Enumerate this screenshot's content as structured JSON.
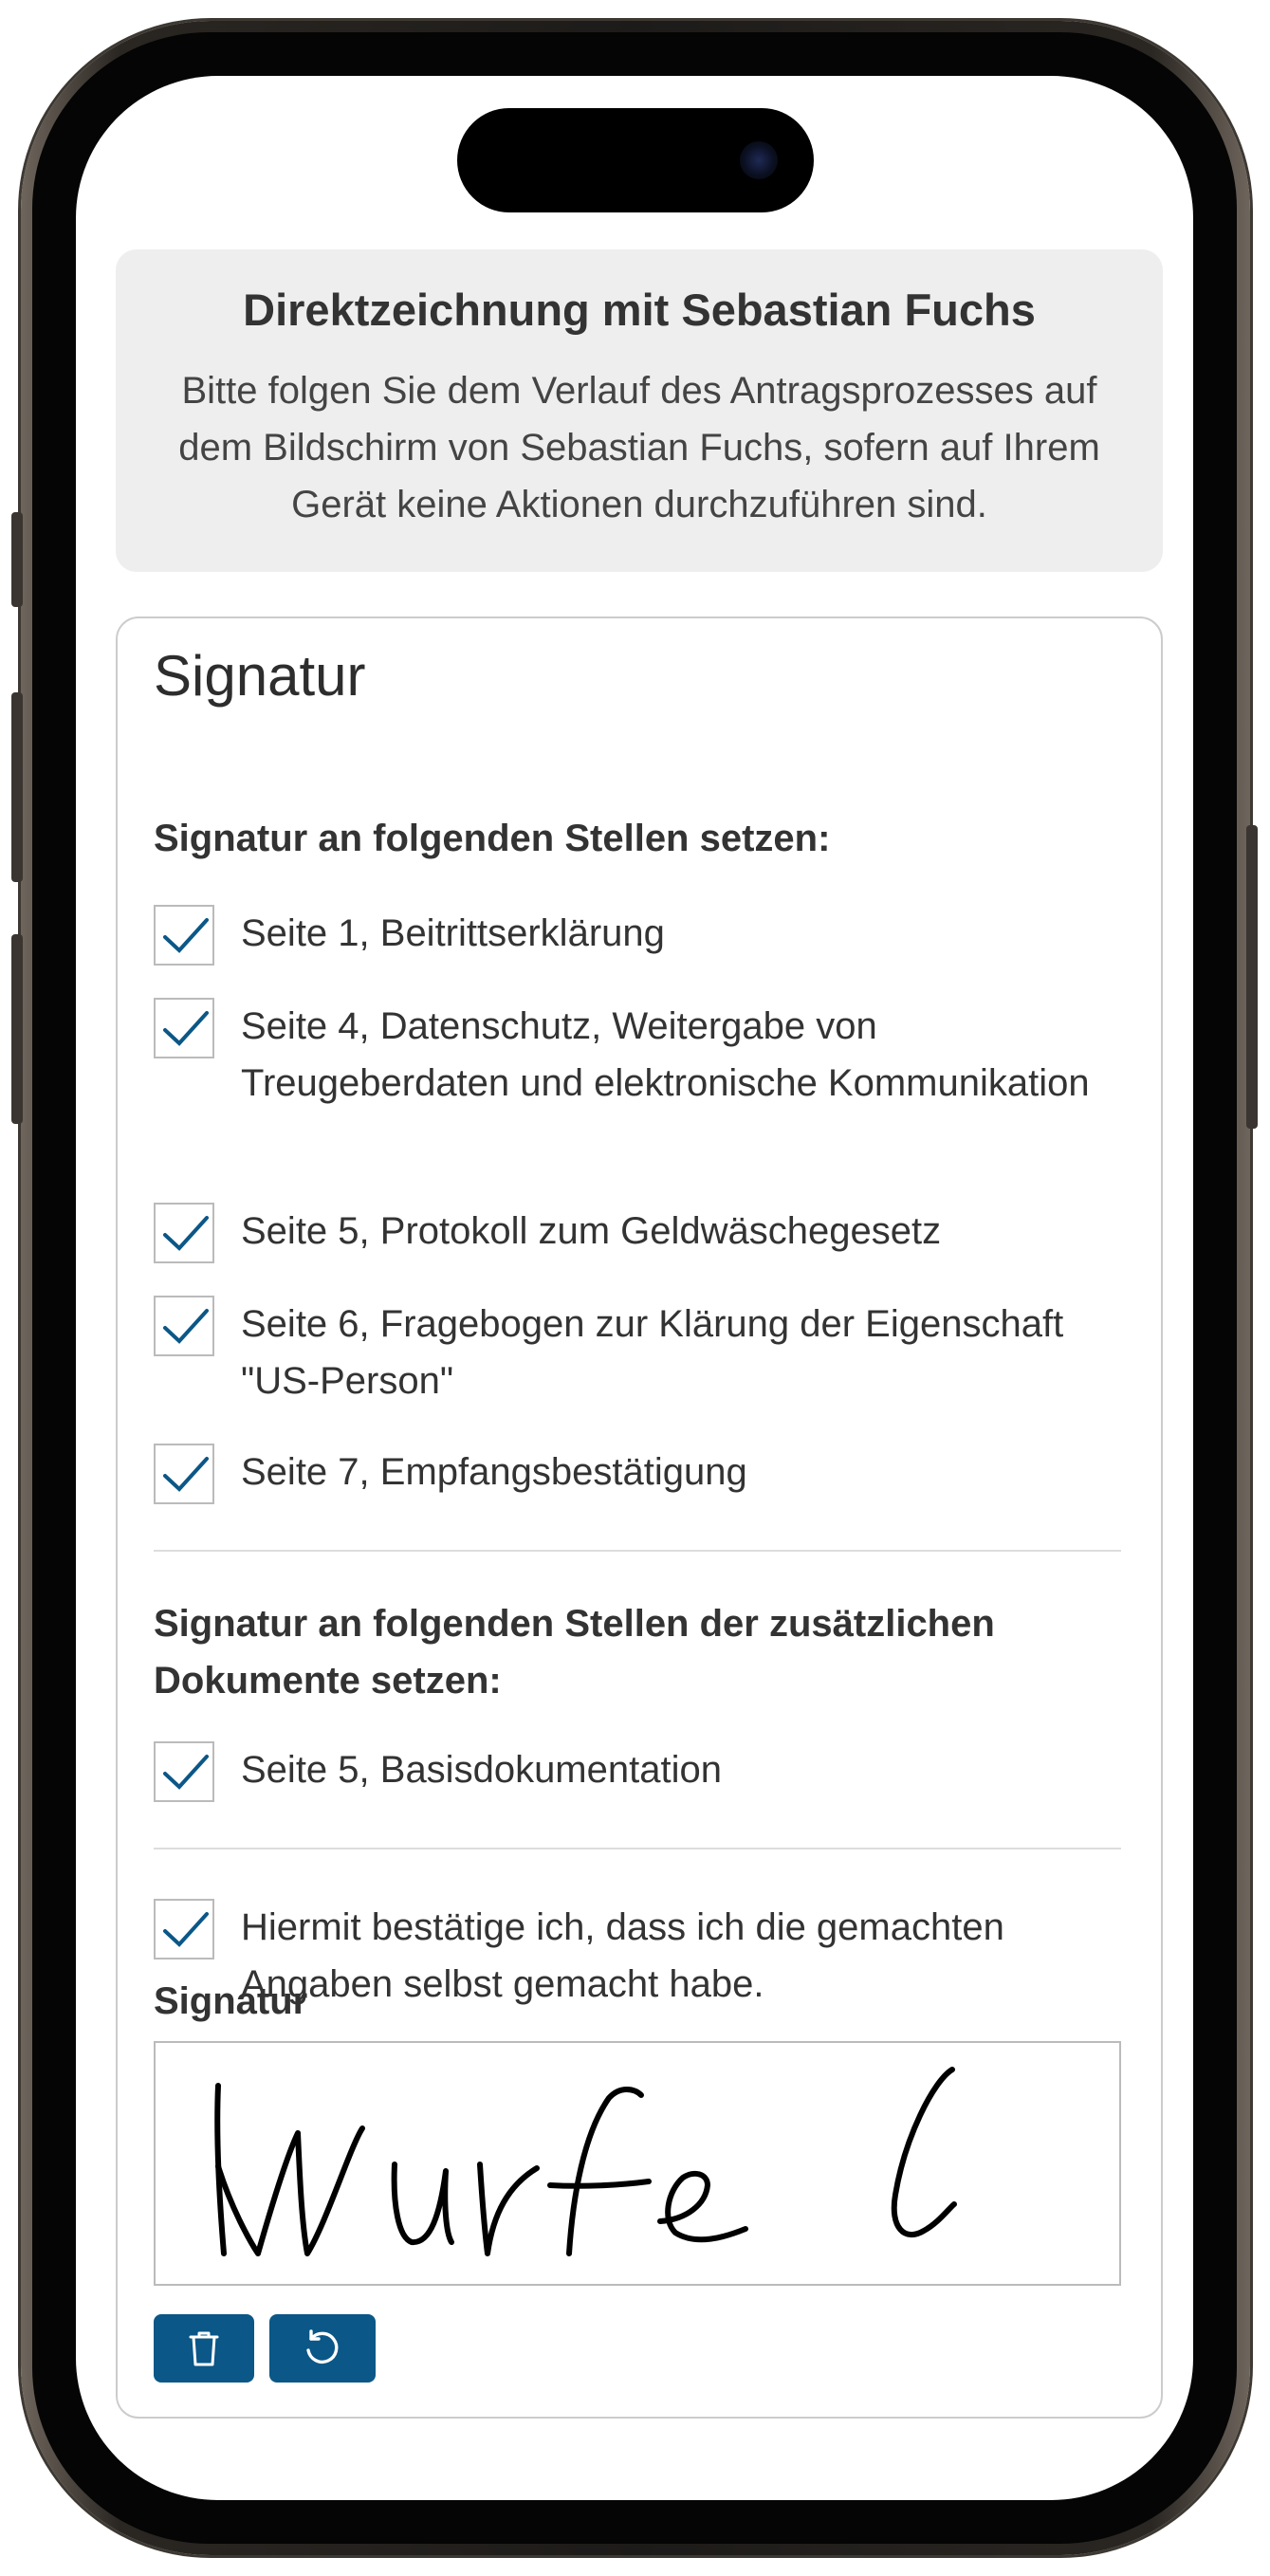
{
  "banner": {
    "title": "Direktzeichnung mit Sebastian Fuchs",
    "text": "Bitte folgen Sie dem Verlauf des Antragsprozesses auf dem Bildschirm von Sebastian Fuchs, sofern auf Ihrem Gerät keine Aktionen durchzuführen sind."
  },
  "card": {
    "title": "Signatur",
    "section1_heading": "Signatur an folgenden Stellen setzen:",
    "section1_items": [
      {
        "label": "Seite 1, Beitrittserklärung",
        "checked": true
      },
      {
        "label": "Seite 4, Datenschutz, Weitergabe von Treugeberdaten und elektronische Kommunikation",
        "checked": true
      },
      {
        "label": "Seite 5, Protokoll zum Geldwäschegesetz",
        "checked": true
      },
      {
        "label": "Seite 6, Fragebogen zur Klärung der Eigenschaft \"US-Person\"",
        "checked": true
      },
      {
        "label": "Seite 7, Empfangsbestätigung",
        "checked": true
      }
    ],
    "section2_heading": "Signatur an folgenden Stellen der zusätzlichen Dokumente setzen:",
    "section2_items": [
      {
        "label": "Seite 5, Basisdokumentation",
        "checked": true
      }
    ],
    "confirmation": {
      "label": "Hiermit bestätige ich, dass ich die gemachten Angaben selbst gemacht habe.",
      "checked": true
    },
    "signature_label": "Signatur",
    "signature_text": "Wurfel",
    "buttons": {
      "clear_icon": "trash-icon",
      "undo_icon": "undo-icon"
    }
  },
  "colors": {
    "accent": "#0b5787",
    "banner_bg": "#eeeeee",
    "check": "#0b5787"
  }
}
